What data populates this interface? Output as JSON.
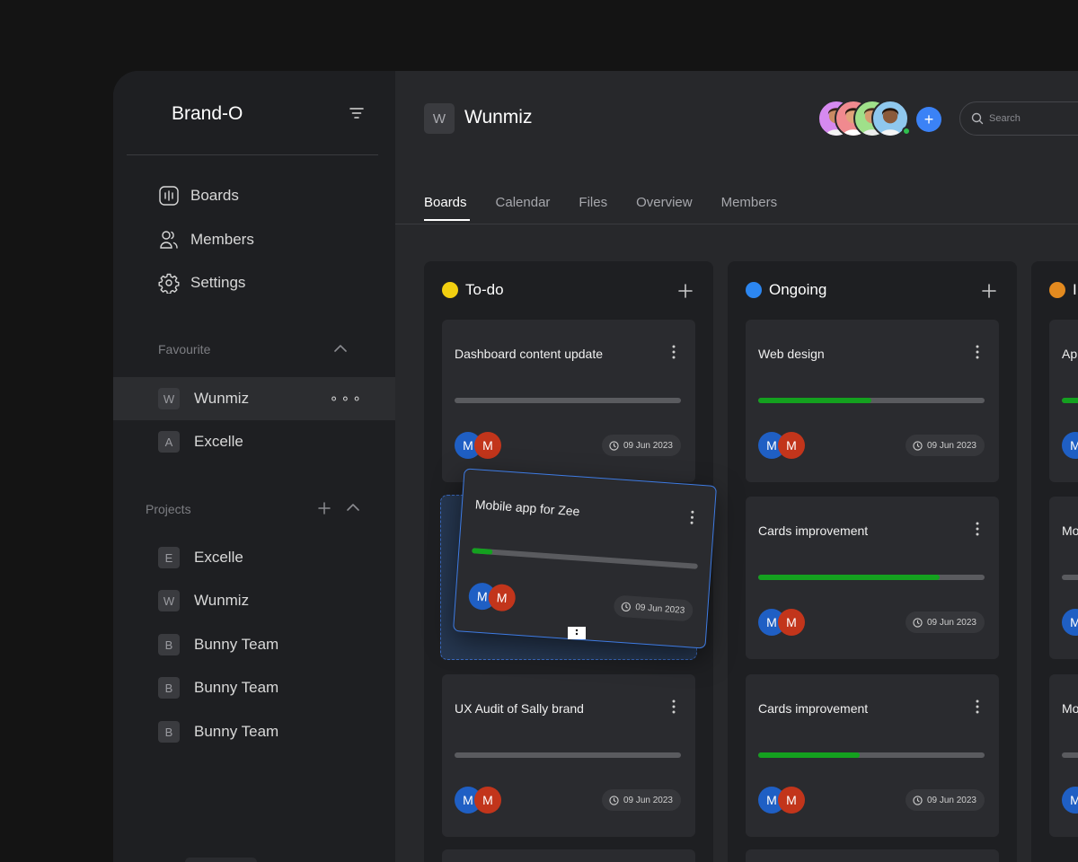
{
  "brand": "Brand-O",
  "nav": [
    {
      "label": "Boards",
      "icon": "boards-icon"
    },
    {
      "label": "Members",
      "icon": "members-icon"
    },
    {
      "label": "Settings",
      "icon": "settings-icon"
    }
  ],
  "favourite": {
    "title": "Favourite",
    "items": [
      {
        "letter": "W",
        "label": "Wunmiz",
        "active": true
      },
      {
        "letter": "A",
        "label": "Excelle"
      }
    ]
  },
  "projects": {
    "title": "Projects",
    "items": [
      {
        "letter": "E",
        "label": "Excelle"
      },
      {
        "letter": "W",
        "label": "Wunmiz"
      },
      {
        "letter": "B",
        "label": "Bunny Team"
      },
      {
        "letter": "B",
        "label": "Bunny Team"
      },
      {
        "letter": "B",
        "label": "Bunny Team"
      }
    ]
  },
  "workspace": {
    "letter": "W",
    "title": "Wunmiz"
  },
  "header": {
    "add_member_label": "+",
    "search_placeholder": "Search"
  },
  "tabs": [
    {
      "label": "Boards",
      "active": true
    },
    {
      "label": "Calendar"
    },
    {
      "label": "Files"
    },
    {
      "label": "Overview"
    },
    {
      "label": "Members"
    }
  ],
  "colors": {
    "todo": "#f2cf10",
    "ongoing": "#2c86f0",
    "third": "#e38a1f",
    "progress": "#14a11f",
    "accent": "#3b82f6"
  },
  "columns": [
    {
      "title": "To-do",
      "color": "#f2cf10",
      "cards": [
        {
          "title": "Dashboard content update",
          "progress": 0,
          "assignees": [
            "M",
            "M"
          ],
          "date": "09 Jun 2023"
        },
        {
          "title": "UX Audit of Sally brand",
          "progress": 0,
          "assignees": [
            "M",
            "M"
          ],
          "date": "09 Jun 2023"
        }
      ]
    },
    {
      "title": "Ongoing",
      "color": "#2c86f0",
      "cards": [
        {
          "title": "Web design",
          "progress": 0.5,
          "assignees": [
            "M",
            "M"
          ],
          "date": "09 Jun 2023"
        },
        {
          "title": "Cards improvement",
          "progress": 0.8,
          "assignees": [
            "M",
            "M"
          ],
          "date": "09 Jun 2023"
        },
        {
          "title": "Cards improvement",
          "progress": 0.45,
          "assignees": [
            "M",
            "M"
          ],
          "date": "09 Jun 2023"
        }
      ]
    },
    {
      "title": "I",
      "color": "#e38a1f",
      "cards": [
        {
          "title": "Ap",
          "progress": 0.3,
          "assignees": [
            "M"
          ],
          "date": ""
        },
        {
          "title": "Mo",
          "progress": 0,
          "assignees": [
            "M"
          ],
          "date": ""
        },
        {
          "title": "Mo",
          "progress": 0,
          "assignees": [
            "M"
          ],
          "date": ""
        }
      ]
    }
  ],
  "dragging_card": {
    "title": "Mobile app for Zee",
    "progress": 0.09,
    "assignees": [
      "M",
      "M"
    ],
    "date": "09 Jun 2023"
  }
}
